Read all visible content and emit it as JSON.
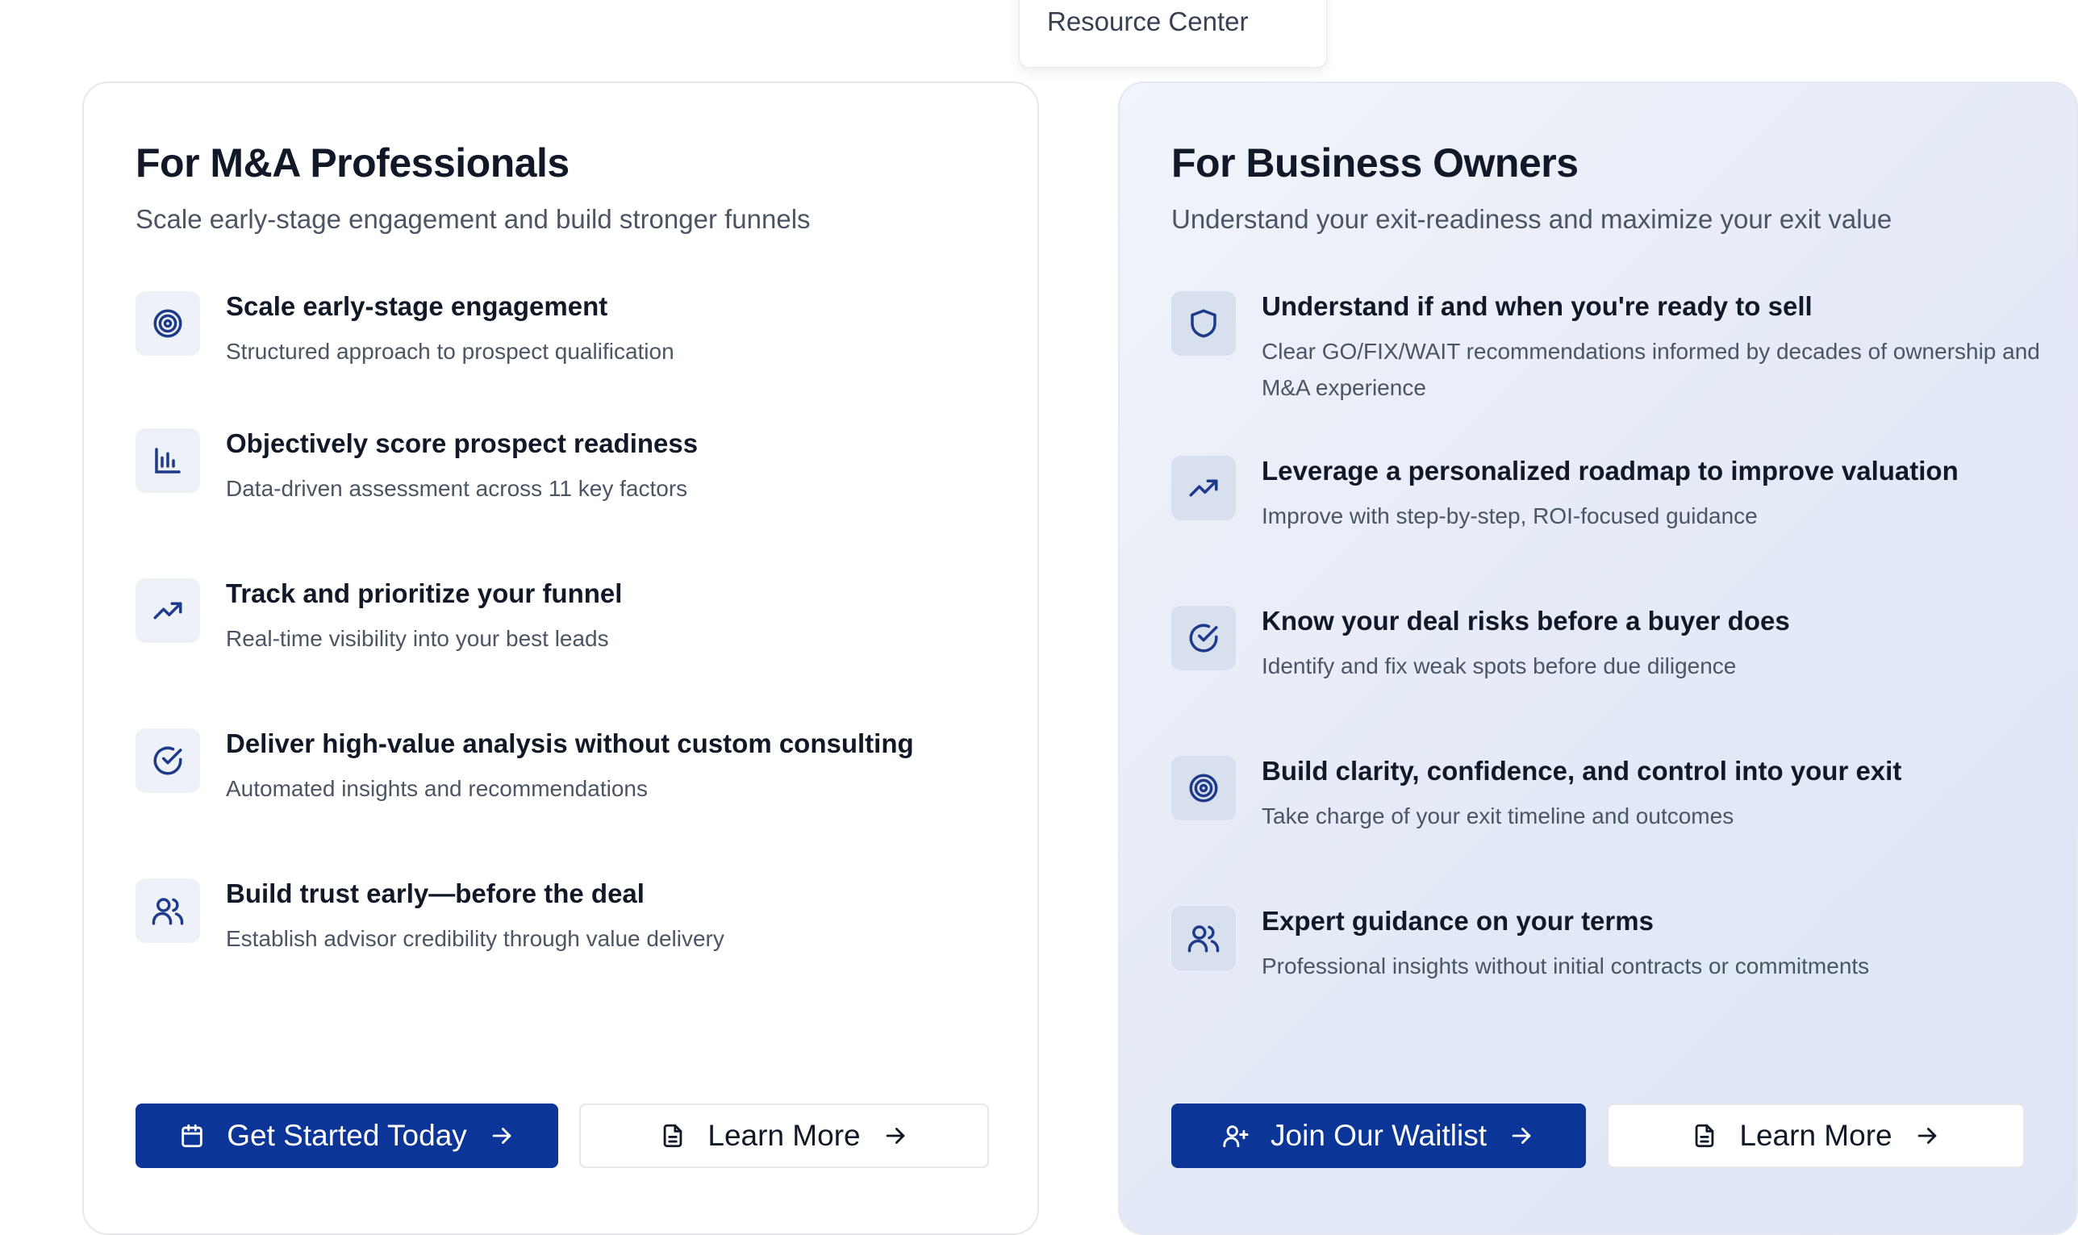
{
  "nav_dropdown": {
    "item": "Resource Center"
  },
  "professionals": {
    "title": "For M&A Professionals",
    "subtitle": "Scale early-stage engagement and build stronger funnels",
    "features": [
      {
        "icon": "target-icon",
        "title": "Scale early-stage engagement",
        "desc": "Structured approach to prospect qualification"
      },
      {
        "icon": "bar-chart-icon",
        "title": "Objectively score prospect readiness",
        "desc": "Data-driven assessment across 11 key factors"
      },
      {
        "icon": "trending-up-icon",
        "title": "Track and prioritize your funnel",
        "desc": "Real-time visibility into your best leads"
      },
      {
        "icon": "check-circle-icon",
        "title": "Deliver high-value analysis without custom consulting",
        "desc": "Automated insights and recommendations"
      },
      {
        "icon": "users-icon",
        "title": "Build trust early—before the deal",
        "desc": "Establish advisor credibility through value delivery"
      }
    ],
    "primary_button": "Get Started Today",
    "secondary_button": "Learn More"
  },
  "owners": {
    "title": "For Business Owners",
    "subtitle": "Understand your exit-readiness and maximize your exit value",
    "features": [
      {
        "icon": "shield-icon",
        "title": "Understand if and when you're ready to sell",
        "desc": "Clear GO/FIX/WAIT recommendations informed by decades of ownership and M&A experience"
      },
      {
        "icon": "trending-up-icon",
        "title": "Leverage a personalized roadmap to improve valuation",
        "desc": "Improve with step-by-step, ROI-focused guidance"
      },
      {
        "icon": "check-circle-icon",
        "title": "Know your deal risks before a buyer does",
        "desc": "Identify and fix weak spots before due diligence"
      },
      {
        "icon": "target-icon",
        "title": "Build clarity, confidence, and control into your exit",
        "desc": "Take charge of your exit timeline and outcomes"
      },
      {
        "icon": "users-icon",
        "title": "Expert guidance on your terms",
        "desc": "Professional insights without initial contracts or commitments"
      }
    ],
    "primary_button": "Join Our Waitlist",
    "secondary_button": "Learn More"
  },
  "colors": {
    "primary": "#0b3596",
    "icon": "#1e3a8a",
    "text": "#111827",
    "muted": "#4b5563",
    "border": "#e5e7eb"
  }
}
